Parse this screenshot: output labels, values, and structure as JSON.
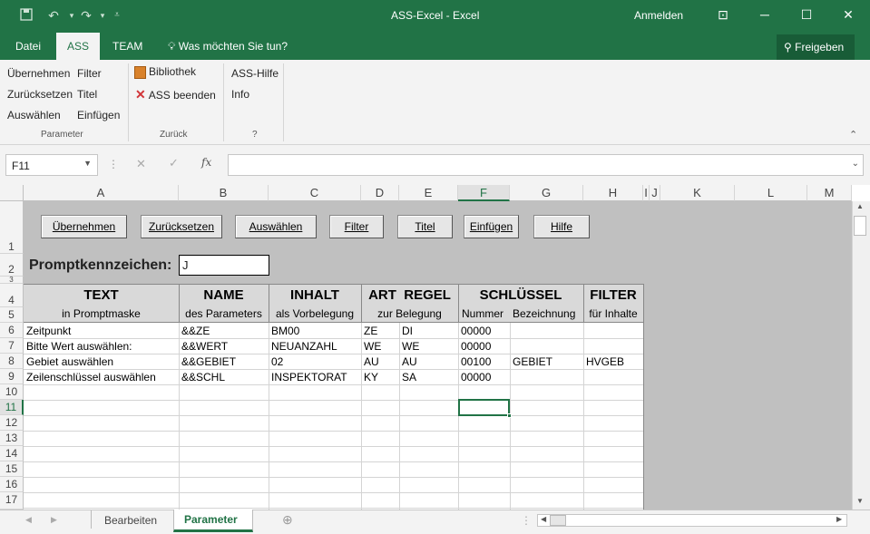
{
  "window": {
    "title": "ASS-Excel  -  Excel",
    "signin": "Anmelden"
  },
  "tabs": [
    "Datei",
    "ASS",
    "TEAM"
  ],
  "tell_me": "Was möchten Sie tun?",
  "share_label": "Freigeben",
  "ribbon": {
    "parameter": {
      "col1": [
        "Übernehmen",
        "Zurücksetzen",
        "Auswählen"
      ],
      "col2": [
        "Filter",
        "Titel",
        "Einfügen"
      ],
      "group": "Parameter"
    },
    "zurueck": {
      "items": [
        "Bibliothek",
        "ASS beenden"
      ],
      "group": "Zurück"
    },
    "help": {
      "items": [
        "ASS-Hilfe",
        "Info"
      ],
      "group": "?"
    }
  },
  "namebox": "F11",
  "fx": "fx",
  "columns": [
    "A",
    "B",
    "C",
    "D",
    "E",
    "F",
    "G",
    "H",
    "I",
    "J",
    "K",
    "L",
    "M"
  ],
  "rows": [
    "1",
    "2",
    "3",
    "4",
    "5",
    "6",
    "7",
    "8",
    "9",
    "10",
    "11",
    "12",
    "13",
    "14",
    "15",
    "16",
    "17"
  ],
  "sheet_buttons": [
    "Übernehmen",
    "Zurücksetzen",
    "Auswählen",
    "Filter",
    "Titel",
    "Einfügen",
    "Hilfe"
  ],
  "prompt": {
    "label": "Promptkennzeichen:",
    "value": "J"
  },
  "headers": {
    "text": "TEXT",
    "text_sub": "in Promptmaske",
    "name": "NAME",
    "name_sub": "des Parameters",
    "inhalt": "INHALT",
    "inhalt_sub": "als Vorbelegung",
    "artregel": "ART  REGEL",
    "artregel_sub": "zur Belegung",
    "schluessel": "SCHLÜSSEL",
    "nummer": "Nummer",
    "bezeichnung": "Bezeichnung",
    "filter": "FILTER",
    "filter_sub": "für Inhalte"
  },
  "data_rows": [
    [
      "Zeitpunkt",
      "&&ZE",
      "BM00",
      "ZE",
      "DI",
      "00000",
      "",
      ""
    ],
    [
      "Bitte Wert auswählen:",
      "&&WERT",
      "NEUANZAHL",
      "WE",
      "WE",
      "00000",
      "",
      ""
    ],
    [
      "Gebiet auswählen",
      "&&GEBIET",
      "02",
      "AU",
      "AU",
      "00100",
      "GEBIET",
      "HVGEB"
    ],
    [
      "Zeilenschlüssel auswählen",
      "&&SCHL",
      "INSPEKTORAT",
      "KY",
      "SA",
      "00000",
      "",
      ""
    ]
  ],
  "sheets": [
    "Bearbeiten",
    "Parameter"
  ],
  "active_sheet": "Parameter"
}
